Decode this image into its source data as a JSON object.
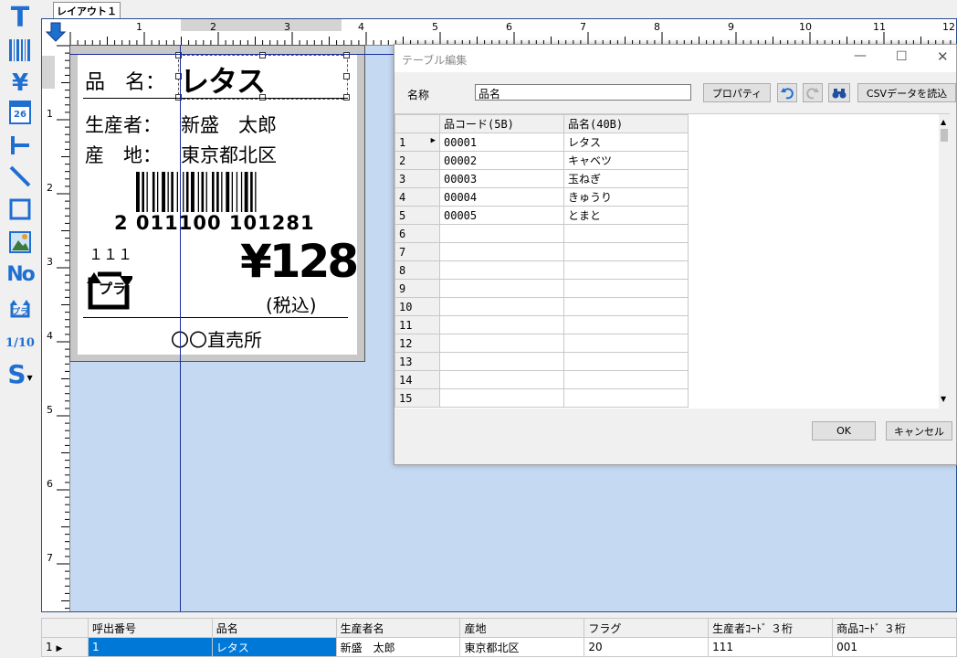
{
  "tabs": [
    {
      "label": "レイアウト１"
    }
  ],
  "toolbar": {
    "tools": [
      {
        "name": "text-tool-icon",
        "glyph": "T"
      },
      {
        "name": "barcode-tool-icon",
        "glyph": ""
      },
      {
        "name": "price-tool-icon",
        "glyph": "¥"
      },
      {
        "name": "date-tool-icon",
        "glyph": "26"
      },
      {
        "name": "line-tool-icon",
        "glyph": ""
      },
      {
        "name": "diagonal-line-tool-icon",
        "glyph": ""
      },
      {
        "name": "rectangle-tool-icon",
        "glyph": ""
      },
      {
        "name": "image-tool-icon",
        "glyph": ""
      },
      {
        "name": "number-tool-icon",
        "glyph": "No"
      },
      {
        "name": "recycle-mark-tool-icon",
        "glyph": "プラ"
      },
      {
        "name": "fraction-tool-icon",
        "glyph": "1/10"
      },
      {
        "name": "symbol-tool-icon",
        "glyph": "S"
      }
    ],
    "accent": "#1f6fd1"
  },
  "ruler": {
    "h_labels": [
      "1",
      "2",
      "3",
      "4",
      "5",
      "6",
      "7",
      "8",
      "9",
      "10",
      "11",
      "12"
    ],
    "v_labels": [
      "1",
      "2",
      "3",
      "4",
      "5",
      "6",
      "7"
    ]
  },
  "label": {
    "name_caption": "品　名：",
    "name_value": "レタス",
    "producer_caption": "生産者：",
    "producer_value": "新盛　太郎",
    "origin_caption": "産　地：",
    "origin_value": "東京都北区",
    "barcode_number": "2 011100 101281",
    "flag_code": "１１１",
    "recycle_mark": "プラ",
    "price": "¥128",
    "tax_note": "(税込)",
    "store": "〇〇直売所"
  },
  "dialog": {
    "title": "テーブル編集",
    "name_caption": "名称",
    "name_value": "品名",
    "property_button": "プロパティ",
    "csv_button": "CSVデータを読込",
    "ok_button": "OK",
    "cancel_button": "キャンセル",
    "columns": [
      "品コード(5B)",
      "品名(40B)"
    ],
    "rows": [
      {
        "num": "1",
        "code": "00001",
        "name": "レタス"
      },
      {
        "num": "2",
        "code": "00002",
        "name": "キャベツ"
      },
      {
        "num": "3",
        "code": "00003",
        "name": "玉ねぎ"
      },
      {
        "num": "4",
        "code": "00004",
        "name": "きゅうり"
      },
      {
        "num": "5",
        "code": "00005",
        "name": "とまと"
      },
      {
        "num": "6",
        "code": "",
        "name": ""
      },
      {
        "num": "7",
        "code": "",
        "name": ""
      },
      {
        "num": "8",
        "code": "",
        "name": ""
      },
      {
        "num": "9",
        "code": "",
        "name": ""
      },
      {
        "num": "10",
        "code": "",
        "name": ""
      },
      {
        "num": "11",
        "code": "",
        "name": ""
      },
      {
        "num": "12",
        "code": "",
        "name": ""
      },
      {
        "num": "13",
        "code": "",
        "name": ""
      },
      {
        "num": "14",
        "code": "",
        "name": ""
      },
      {
        "num": "15",
        "code": "",
        "name": ""
      }
    ]
  },
  "bottom_grid": {
    "headers": [
      "呼出番号",
      "品名",
      "生産者名",
      "産地",
      "フラグ",
      "生産者ｺｰﾄﾞ ３桁",
      "商品ｺｰﾄﾞ ３桁"
    ],
    "row_num": "1",
    "cells": [
      "1",
      "レタス",
      "新盛　太郎",
      "東京都北区",
      "20",
      "111",
      "001"
    ],
    "selection_color": "#0078d7"
  }
}
